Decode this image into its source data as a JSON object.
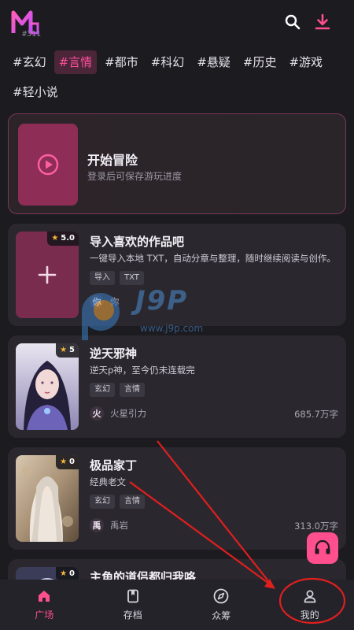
{
  "header": {
    "logo_badge": "#311",
    "search_icon": "search-icon",
    "download_icon": "download-icon",
    "accent": "#ff4f8d"
  },
  "tags": [
    "#玄幻",
    "#言情",
    "#都市",
    "#科幻",
    "#悬疑",
    "#历史",
    "#游戏",
    "#轻小说"
  ],
  "active_tag": "#言情",
  "adventure": {
    "title": "开始冒险",
    "subtitle": "登录后可保存游玩进度"
  },
  "books": [
    {
      "rating": "5.0",
      "title": "导入喜欢的作品吧",
      "desc": "一键导入本地 TXT，自动分章与整理，随时继续阅读与创作。",
      "chips": [
        "导入",
        "TXT"
      ],
      "avatar": "你",
      "author": "你",
      "words": ""
    },
    {
      "rating": "5",
      "title": "逆天邪神",
      "desc": "逆天p神，至今仍未连载完",
      "chips": [
        "玄幻",
        "言情"
      ],
      "avatar": "火",
      "author": "火星引力",
      "words": "685.7万字"
    },
    {
      "rating": "0",
      "title": "极品家丁",
      "desc": "经典老文",
      "chips": [
        "玄幻",
        "言情"
      ],
      "avatar": "禹",
      "author": "禹岩",
      "words": "313.0万字"
    },
    {
      "rating": "0",
      "title": "主角的道侣都归我咯",
      "desc": "",
      "chips": [],
      "avatar": "",
      "author": "",
      "words": ""
    }
  ],
  "watermark": {
    "title": "J9P",
    "url": "www.j9p.com"
  },
  "nav": [
    {
      "label": "广场",
      "icon": "home-icon"
    },
    {
      "label": "存档",
      "icon": "bookmark-icon"
    },
    {
      "label": "众筹",
      "icon": "compass-icon"
    },
    {
      "label": "我的",
      "icon": "user-icon"
    }
  ],
  "nav_active_index": 0
}
